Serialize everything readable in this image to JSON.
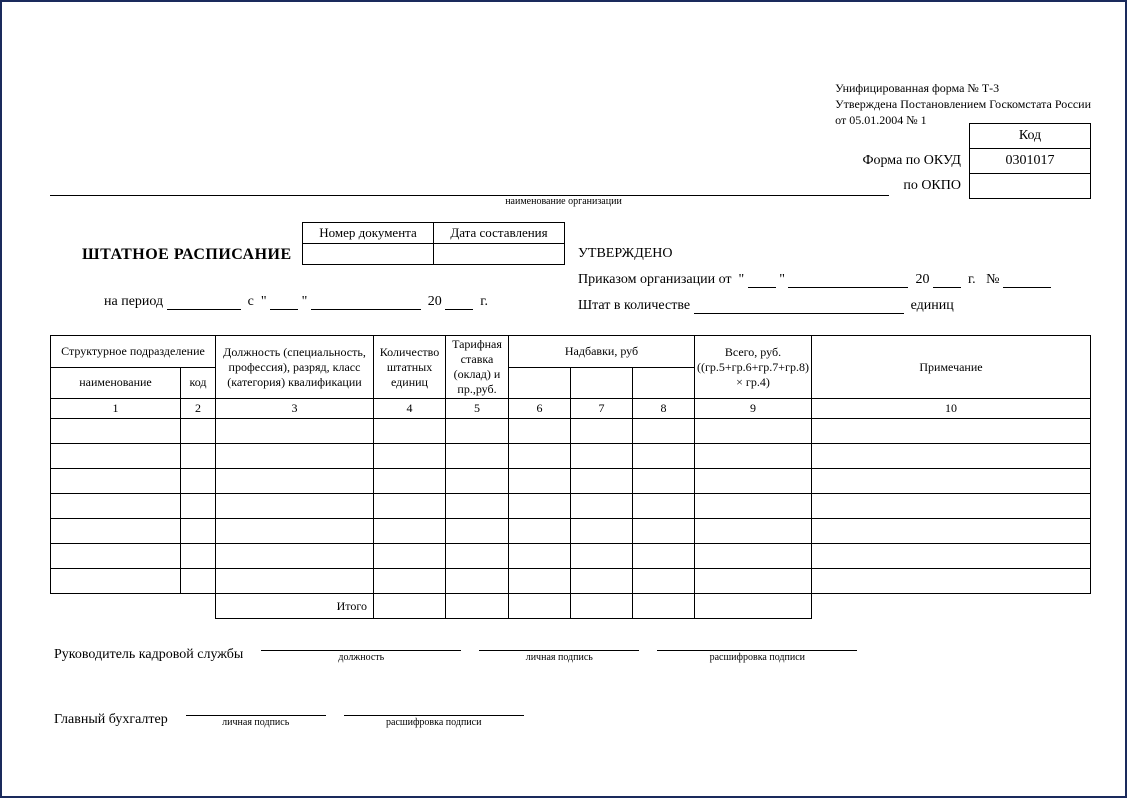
{
  "header": {
    "form_line1": "Унифицированная форма № Т-3",
    "form_line2": "Утверждена Постановлением Госкомстата России",
    "form_line3": "от 05.01.2004 № 1",
    "kod_header": "Код",
    "okud_label": "Форма по ОКУД",
    "okud_value": "0301017",
    "okpo_label": "по ОКПО",
    "org_caption": "наименование организации"
  },
  "docmeta": {
    "num_hdr": "Номер документа",
    "date_hdr": "Дата составления",
    "title": "ШТАТНОЕ РАСПИСАНИЕ",
    "period_prefix": "на период",
    "period_s": "с",
    "quote": "\"",
    "year_prefix": "20",
    "year_suffix": "г."
  },
  "approve": {
    "approved": "УТВЕРЖДЕНО",
    "order_prefix": "Приказом организации от",
    "no": "№",
    "staff_prefix": "Штат в количестве",
    "units": "единиц"
  },
  "table": {
    "col1_top": "Структурное подразделение",
    "col1a": "наименование",
    "col1b": "код",
    "col3": "Должность (специальность, профессия), разряд, класс (категория) квалификации",
    "col4": "Количество штатных единиц",
    "col5": "Тарифная ставка (оклад) и пр.,руб.",
    "col678": "Надбавки, руб",
    "col9": "Всего, руб. ((гр.5+гр.6+гр.7+гр.8) × гр.4)",
    "col10": "Примечание",
    "n1": "1",
    "n2": "2",
    "n3": "3",
    "n4": "4",
    "n5": "5",
    "n6": "6",
    "n7": "7",
    "n8": "8",
    "n9": "9",
    "n10": "10",
    "total": "Итого"
  },
  "signs": {
    "hr_head_label": "Руководитель кадровой службы",
    "position": "должность",
    "signature": "личная подпись",
    "decipher": "расшифровка подписи",
    "chief_acc": "Главный бухгалтер"
  }
}
